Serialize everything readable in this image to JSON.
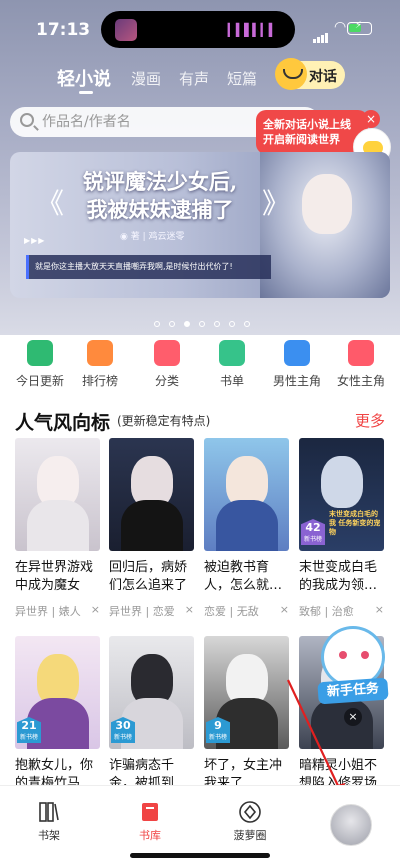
{
  "status_bar": {
    "time": "17:13"
  },
  "top_tabs": {
    "items": [
      {
        "label": "轻小说"
      },
      {
        "label": "漫画"
      },
      {
        "label": "有声"
      },
      {
        "label": "短篇"
      }
    ],
    "chat_label": "对话"
  },
  "search": {
    "placeholder": "作品名/作者名"
  },
  "promo_popup": {
    "line1": "全新对话小说上线",
    "line2": "开启新阅读世界",
    "close": "×"
  },
  "banner": {
    "title_line1": "锐评魔法少女后,",
    "title_line2": "我被妹妹逮捕了",
    "author": "◉ 著 | 鸡云迷零",
    "quote": "就是你这主播大放天天直播嘲弄我啊,是时候付出代价了!",
    "page_index": 3,
    "page_count": 7
  },
  "categories": [
    {
      "label": "今日更新",
      "icon": "calendar-icon",
      "color": "#2fba72"
    },
    {
      "label": "排行榜",
      "icon": "ranking-icon",
      "color": "#ff8a3d"
    },
    {
      "label": "分类",
      "icon": "grid-icon",
      "color": "#ff5d6c"
    },
    {
      "label": "书单",
      "icon": "booklist-icon",
      "color": "#36c38a"
    },
    {
      "label": "男性主角",
      "icon": "male-icon",
      "color": "#3b8ff0"
    },
    {
      "label": "女性主角",
      "icon": "female-icon",
      "color": "#ff5a6a"
    }
  ],
  "section": {
    "title": "人气风向标",
    "subtitle": "(更新稳定有特点)",
    "more": "更多"
  },
  "books_row1": [
    {
      "name": "在异世界游戏中成为魔女",
      "tags": "异世界 | 婊人",
      "x": "×"
    },
    {
      "name": "回归后，病娇们怎么追来了",
      "tags": "异世界 | 恋爱",
      "x": "×"
    },
    {
      "name": "被迫教书育人，怎么就…",
      "tags": "恋爱 | 无敌",
      "x": "×"
    },
    {
      "name": "末世变成白毛的我成为领…",
      "tags": "致郁 | 治愈",
      "x": "×",
      "cover_text": "末世变成白毛的我 任务新变的宠物",
      "badge": "42"
    }
  ],
  "books_row2": [
    {
      "name": "抱歉女儿，你的青梅竹马…",
      "badge": "21"
    },
    {
      "name": "诈骗病态千金，被抓到…",
      "badge": "30"
    },
    {
      "name": "坏了，女主冲我来了",
      "badge": "9"
    },
    {
      "name": "暗精灵小姐不想陷入修罗场"
    }
  ],
  "badge_sub": "新书榜",
  "new_task": {
    "label": "新手任务",
    "close": "×"
  },
  "bottom_nav": [
    {
      "label": "书架",
      "icon": "bookshelf-icon"
    },
    {
      "label": "书库",
      "icon": "library-icon"
    },
    {
      "label": "菠萝圈",
      "icon": "pineapple-circle-icon"
    }
  ],
  "colors": {
    "accent": "#f04444",
    "badge": "#2c9ad3",
    "hero": "#a9aec6"
  }
}
